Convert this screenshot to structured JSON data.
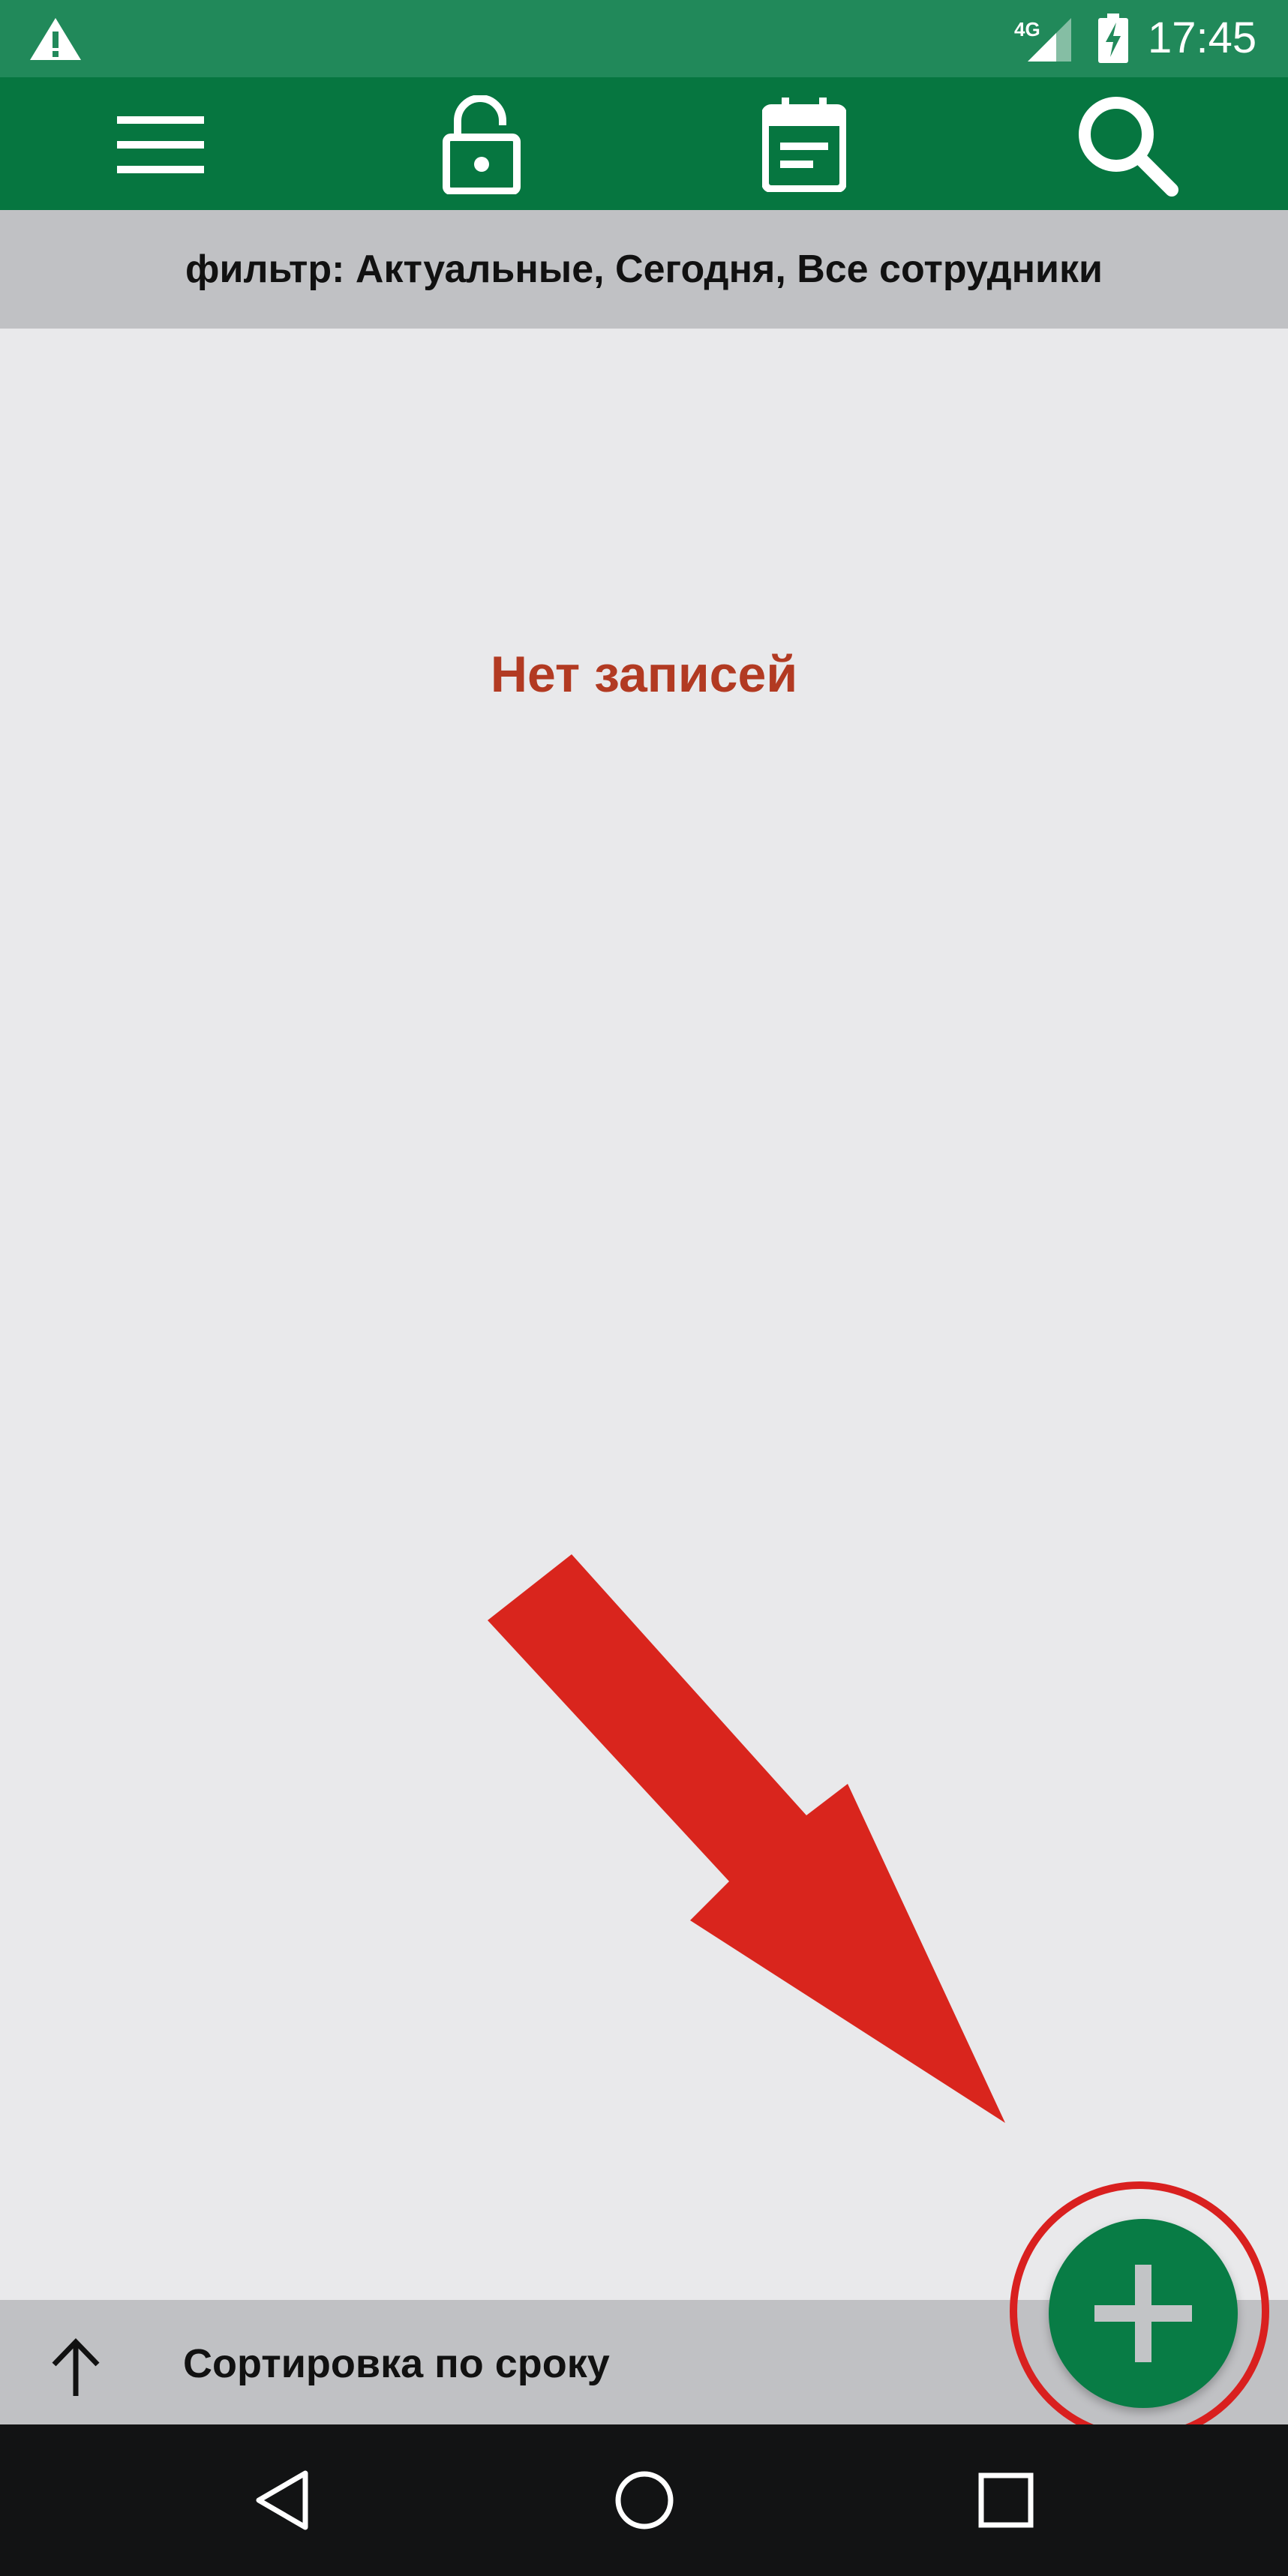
{
  "status_bar": {
    "time": "17:45",
    "network_label": "4G",
    "icons": [
      "warning-icon",
      "signal-icon",
      "battery-charging-icon"
    ]
  },
  "toolbar": {
    "icons": [
      "menu-icon",
      "unlock-icon",
      "calendar-icon",
      "search-icon"
    ]
  },
  "filter": {
    "text": "фильтр: Актуальные, Сегодня, Все сотрудники"
  },
  "list": {
    "empty_text": "Нет записей"
  },
  "sort": {
    "label": "Сортировка по сроку",
    "direction_icon": "arrow-up-icon"
  },
  "fab": {
    "icon": "plus-icon"
  },
  "nav_bar": {
    "icons": [
      "back-icon",
      "home-icon",
      "recents-icon"
    ]
  },
  "colors": {
    "status_bar": "#21895a",
    "toolbar": "#067640",
    "fab": "#087c45",
    "empty_text": "#b23a22",
    "annotation": "#d9251d"
  }
}
